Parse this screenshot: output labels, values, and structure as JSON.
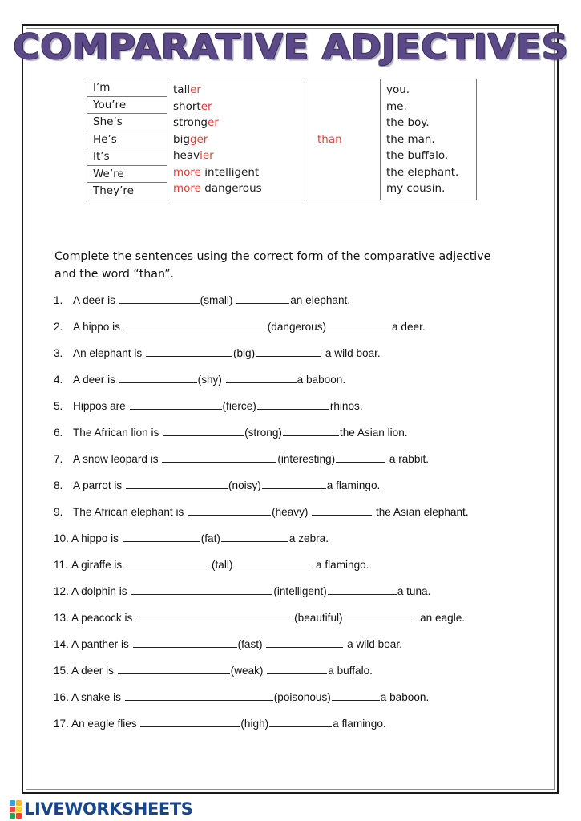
{
  "title": "COMPARATIVE ADJECTIVES",
  "theme": {
    "title_color": "#5B4A87",
    "title_outline_color": "#3B2F5C",
    "accent_red": "#EE3B33",
    "logo_blue": "#17468C",
    "frame_color": "#1A1A1A",
    "table_border_color": "#767676"
  },
  "grammar_table": {
    "subjects": [
      "I’m",
      "You’re",
      "She’s",
      "He’s",
      "It’s",
      "We’re",
      "They’re"
    ],
    "adjectives": [
      {
        "stem": "tall",
        "suffix": "er",
        "prefix": ""
      },
      {
        "stem": "short",
        "suffix": "er",
        "prefix": ""
      },
      {
        "stem": "strong",
        "suffix": "er",
        "prefix": ""
      },
      {
        "stem": "big",
        "suffix": "ger",
        "prefix": ""
      },
      {
        "stem": "heav",
        "suffix": "ier",
        "prefix": ""
      },
      {
        "stem": "intelligent",
        "suffix": "",
        "prefix": "more"
      },
      {
        "stem": "dangerous",
        "suffix": "",
        "prefix": "more"
      }
    ],
    "than_label": "than",
    "objects": [
      "you.",
      "me.",
      "the boy.",
      "the man.",
      "the buffalo.",
      "the elephant.",
      "my cousin."
    ]
  },
  "instructions": "Complete the sentences using the correct form of the comparative adjective and the word “than”.",
  "exercises": [
    {
      "num": "1.",
      "pre": "A deer is",
      "blank1": 100,
      "adj": "(small)",
      "gap": " ",
      "blank2": 66,
      "post": "an elephant."
    },
    {
      "num": "2.",
      "pre": "A hippo is",
      "blank1": 178,
      "adj": "(dangerous)",
      "gap": "",
      "blank2": 80,
      "post": "a deer."
    },
    {
      "num": "3.",
      "pre": "An elephant is",
      "blank1": 108,
      "adj": "(big)",
      "gap": "",
      "blank2": 82,
      "post": " a wild boar."
    },
    {
      "num": "4.",
      "pre": "A deer is",
      "blank1": 97,
      "adj": "(shy)",
      "gap": " ",
      "blank2": 88,
      "post": "a baboon."
    },
    {
      "num": "5.",
      "pre": "Hippos are",
      "blank1": 115,
      "adj": "(fierce)",
      "gap": "",
      "blank2": 90,
      "post": "rhinos."
    },
    {
      "num": "6.",
      "pre": "The African lion is",
      "blank1": 101,
      "adj": "(strong)",
      "gap": "",
      "blank2": 70,
      "post": "the Asian lion."
    },
    {
      "num": "7.",
      "pre": "A snow leopard is",
      "blank1": 143,
      "adj": "(interesting)",
      "gap": "",
      "blank2": 62,
      "post": " a rabbit."
    },
    {
      "num": "8.",
      "pre": "A parrot is",
      "blank1": 127,
      "adj": "(noisy)",
      "gap": "",
      "blank2": 80,
      "post": "a flamingo."
    },
    {
      "num": "9.",
      "pre": "The African elephant is",
      "blank1": 104,
      "adj": "(heavy)",
      "gap": " ",
      "blank2": 75,
      "post": " the Asian elephant."
    },
    {
      "num": "10.",
      "pre": "A hippo is",
      "blank1": 97,
      "adj": "(fat)",
      "gap": "",
      "blank2": 84,
      "post": "a zebra."
    },
    {
      "num": "11.",
      "pre": "A giraffe is",
      "blank1": 106,
      "adj": "(tall)",
      "gap": " ",
      "blank2": 94,
      "post": " a flamingo."
    },
    {
      "num": "12.",
      "pre": "A dolphin is",
      "blank1": 177,
      "adj": "(intelligent)",
      "gap": "",
      "blank2": 86,
      "post": "a tuna."
    },
    {
      "num": "13.",
      "pre": "A peacock is",
      "blank1": 196,
      "adj": "(beautiful)",
      "gap": " ",
      "blank2": 87,
      "post": " an eagle."
    },
    {
      "num": "14.",
      "pre": "A panther is",
      "blank1": 130,
      "adj": "(fast)",
      "gap": " ",
      "blank2": 96,
      "post": " a wild boar."
    },
    {
      "num": "15.",
      "pre": "A deer is",
      "blank1": 140,
      "adj": "(weak)",
      "gap": " ",
      "blank2": 75,
      "post": "a buffalo."
    },
    {
      "num": "16.",
      "pre": "A snake is",
      "blank1": 185,
      "adj": "(poisonous)",
      "gap": "",
      "blank2": 60,
      "post": "a baboon."
    },
    {
      "num": "17.",
      "pre": "An eagle flies",
      "blank1": 124,
      "adj": "(high)",
      "gap": "",
      "blank2": 78,
      "post": "a flamingo."
    }
  ],
  "footer": {
    "logo_text": "LIVEWORKSHEETS",
    "logo_tiles": [
      "#3AA0DC",
      "#F2B632",
      "#E84C3D",
      "#F5D43A",
      "#2E9E52",
      "#E8452F"
    ]
  }
}
